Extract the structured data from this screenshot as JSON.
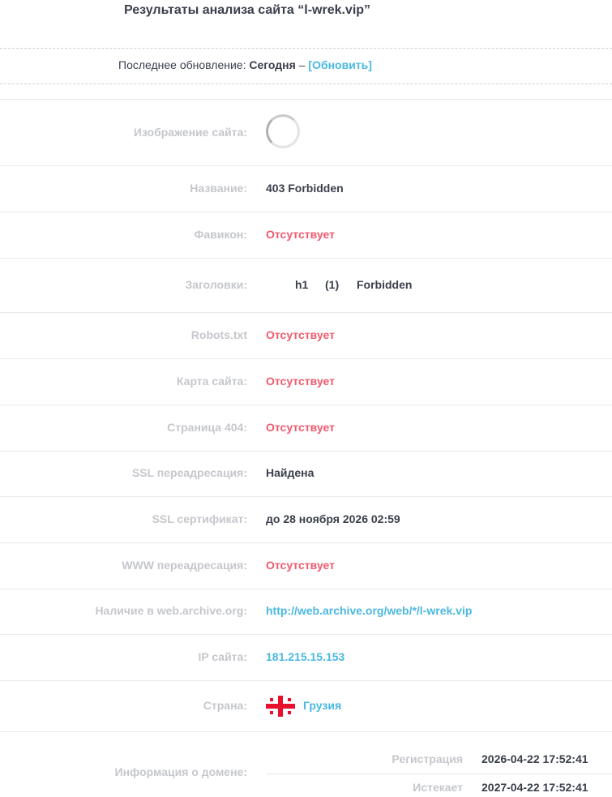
{
  "header": {
    "title": "Результаты анализа сайта “l-wrek.vip”",
    "update_label": "Последнее обновление:",
    "update_value": "Сегодня",
    "update_sep": "–",
    "refresh_link": "[Обновить]"
  },
  "rows": {
    "screenshot": {
      "label": "Изображение сайта:"
    },
    "title": {
      "label": "Название:",
      "value": "403 Forbidden"
    },
    "favicon": {
      "label": "Фавикон:",
      "value": "Отсутствует"
    },
    "headings": {
      "label": "Заголовки:",
      "tag": "h1",
      "count": "(1)",
      "value": "Forbidden"
    },
    "robots": {
      "label": "Robots.txt",
      "value": "Отсутствует"
    },
    "sitemap": {
      "label": "Карта сайта:",
      "value": "Отсутствует"
    },
    "page404": {
      "label": "Страница 404:",
      "value": "Отсутствует"
    },
    "ssl_redirect": {
      "label": "SSL переадресация:",
      "value": "Найдена"
    },
    "ssl_cert": {
      "label": "SSL сертификат:",
      "value": "до 28 ноября 2026 02:59"
    },
    "www_redirect": {
      "label": "WWW переадресация:",
      "value": "Отсутствует"
    },
    "archive": {
      "label": "Наличие в web.archive.org:",
      "value": "http://web.archive.org/web/*/l-wrek.vip"
    },
    "ip": {
      "label": "IP сайта:",
      "value": "181.215.15.153"
    },
    "country": {
      "label": "Страна:",
      "value": "Грузия",
      "flag_icon": "georgia-flag-icon"
    },
    "domain": {
      "label": "Информация о домене:",
      "registration_label": "Регистрация",
      "registration_value": "2026-04-22 17:52:41",
      "expires_label": "Истекает",
      "expires_value": "2027-04-22 17:52:41"
    }
  },
  "colors": {
    "accent": "#4bb8e0",
    "missing": "#f05a6e",
    "label": "#c5c7cc",
    "text": "#3a3f4b"
  }
}
